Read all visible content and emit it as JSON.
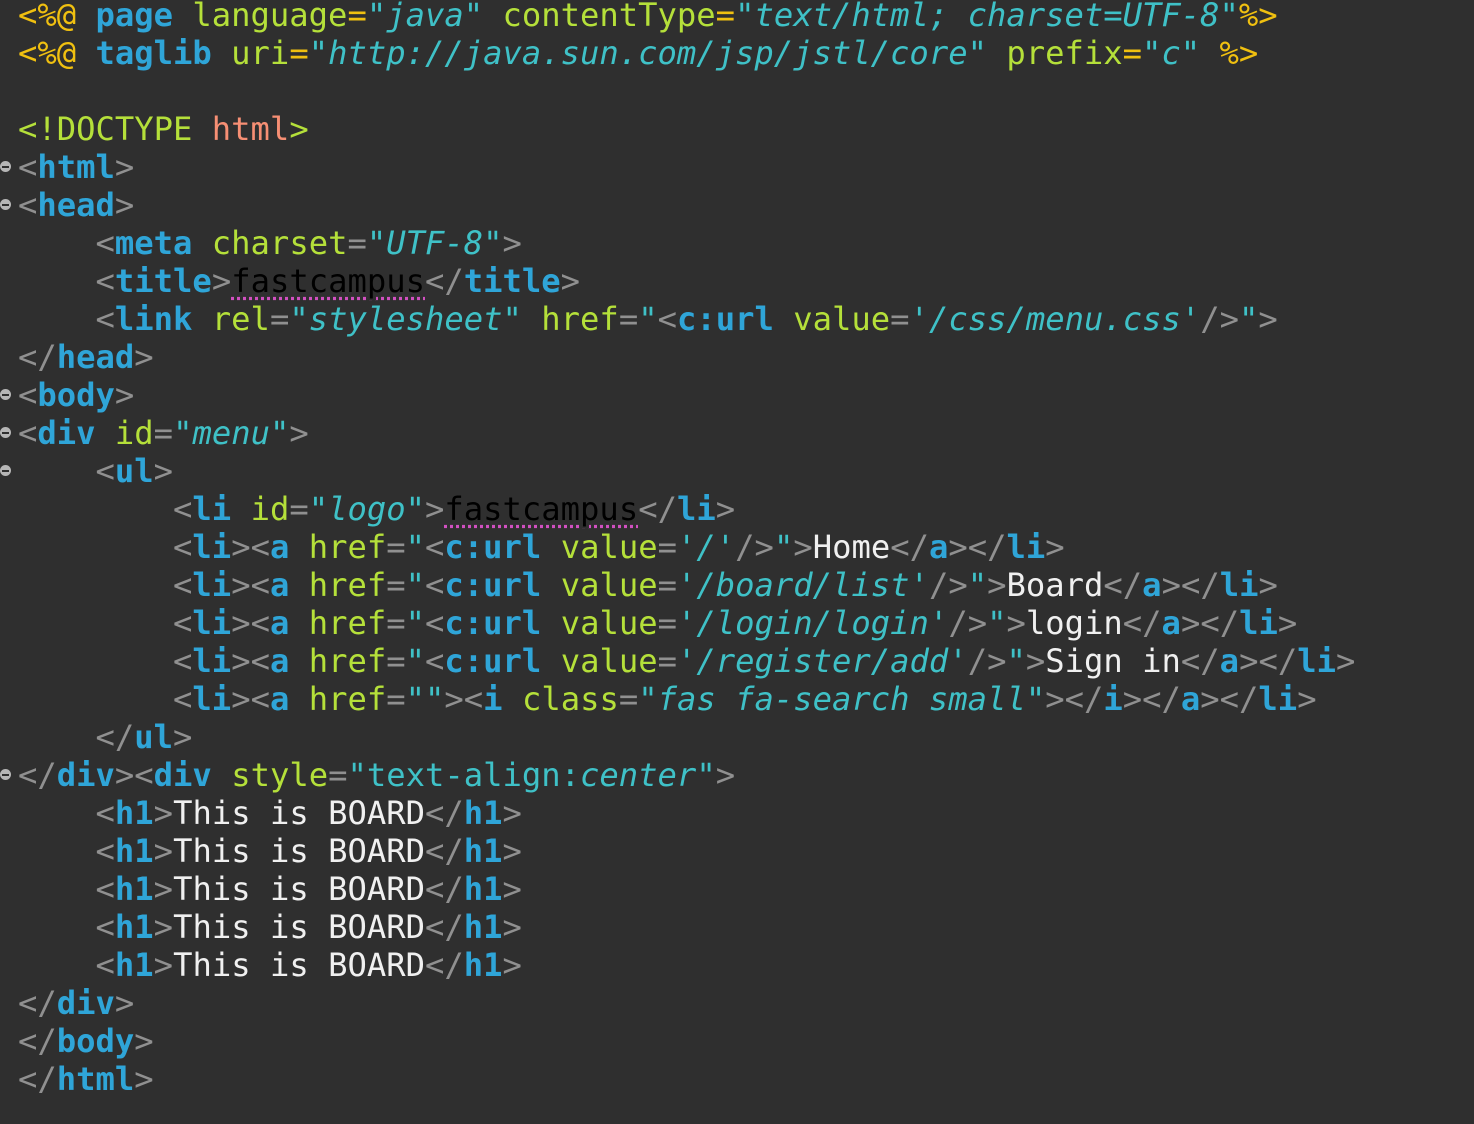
{
  "editor": {
    "lines": [
      [
        [
          "j",
          "<%@ "
        ],
        [
          "jk",
          "page"
        ],
        [
          "ja",
          " language"
        ],
        [
          "j",
          "="
        ],
        [
          "js",
          "\"java\""
        ],
        [
          "ja",
          " contentType"
        ],
        [
          "j",
          "="
        ],
        [
          "js",
          "\"text/html; charset=UTF-8\""
        ],
        [
          "j",
          "%>"
        ]
      ],
      [
        [
          "j",
          "<%@ "
        ],
        [
          "jk",
          "taglib"
        ],
        [
          "ja",
          " uri"
        ],
        [
          "j",
          "="
        ],
        [
          "js",
          "\"http://java.sun.com/jsp/jstl/core\""
        ],
        [
          "ja",
          " prefix"
        ],
        [
          "j",
          "="
        ],
        [
          "js",
          "\"c\""
        ],
        [
          "j",
          " %>"
        ]
      ],
      [],
      [
        [
          "dk",
          "<!DOCTYPE "
        ],
        [
          "dh",
          "html"
        ],
        [
          "dk",
          ">"
        ]
      ],
      [
        [
          "p",
          "<"
        ],
        [
          "t",
          "html"
        ],
        [
          "p",
          ">"
        ]
      ],
      [
        [
          "p",
          "<"
        ],
        [
          "t",
          "head"
        ],
        [
          "p",
          ">"
        ]
      ],
      [
        [
          "d",
          "    "
        ],
        [
          "p",
          "<"
        ],
        [
          "t",
          "meta"
        ],
        [
          "a",
          " charset"
        ],
        [
          "p",
          "="
        ],
        [
          "q",
          "\""
        ],
        [
          "s",
          "UTF-8"
        ],
        [
          "q",
          "\""
        ],
        [
          "p",
          ">"
        ]
      ],
      [
        [
          "d",
          "    "
        ],
        [
          "p",
          "<"
        ],
        [
          "t",
          "title"
        ],
        [
          "p",
          ">"
        ],
        [
          "sp",
          "fastcampus"
        ],
        [
          "p",
          "</"
        ],
        [
          "t",
          "title"
        ],
        [
          "p",
          ">"
        ]
      ],
      [
        [
          "d",
          "    "
        ],
        [
          "p",
          "<"
        ],
        [
          "t",
          "link"
        ],
        [
          "a",
          " rel"
        ],
        [
          "p",
          "="
        ],
        [
          "q",
          "\""
        ],
        [
          "s",
          "stylesheet"
        ],
        [
          "q",
          "\""
        ],
        [
          "a",
          " href"
        ],
        [
          "p",
          "="
        ],
        [
          "q",
          "\""
        ],
        [
          "p",
          "<"
        ],
        [
          "t",
          "c:url"
        ],
        [
          "a",
          " value"
        ],
        [
          "p",
          "="
        ],
        [
          "q",
          "'"
        ],
        [
          "s",
          "/css/menu.css"
        ],
        [
          "q",
          "'"
        ],
        [
          "p",
          "/>"
        ],
        [
          "q",
          "\""
        ],
        [
          "p",
          ">"
        ]
      ],
      [
        [
          "p",
          "</"
        ],
        [
          "t",
          "head"
        ],
        [
          "p",
          ">"
        ]
      ],
      [
        [
          "p",
          "<"
        ],
        [
          "t",
          "body"
        ],
        [
          "p",
          ">"
        ]
      ],
      [
        [
          "p",
          "<"
        ],
        [
          "t",
          "div"
        ],
        [
          "a",
          " id"
        ],
        [
          "p",
          "="
        ],
        [
          "q",
          "\""
        ],
        [
          "s",
          "menu"
        ],
        [
          "q",
          "\""
        ],
        [
          "p",
          ">"
        ]
      ],
      [
        [
          "d",
          "    "
        ],
        [
          "p",
          "<"
        ],
        [
          "t",
          "ul"
        ],
        [
          "p",
          ">"
        ]
      ],
      [
        [
          "d",
          "        "
        ],
        [
          "p",
          "<"
        ],
        [
          "t",
          "li"
        ],
        [
          "a",
          " id"
        ],
        [
          "p",
          "="
        ],
        [
          "q",
          "\""
        ],
        [
          "s",
          "logo"
        ],
        [
          "q",
          "\""
        ],
        [
          "p",
          ">"
        ],
        [
          "sp",
          "fastcampus"
        ],
        [
          "p",
          "</"
        ],
        [
          "t",
          "li"
        ],
        [
          "p",
          ">"
        ]
      ],
      [
        [
          "d",
          "        "
        ],
        [
          "p",
          "<"
        ],
        [
          "t",
          "li"
        ],
        [
          "p",
          "><"
        ],
        [
          "t",
          "a"
        ],
        [
          "a",
          " href"
        ],
        [
          "p",
          "="
        ],
        [
          "q",
          "\""
        ],
        [
          "p",
          "<"
        ],
        [
          "t",
          "c:url"
        ],
        [
          "a",
          " value"
        ],
        [
          "p",
          "="
        ],
        [
          "q",
          "'"
        ],
        [
          "s",
          "/"
        ],
        [
          "q",
          "'"
        ],
        [
          "p",
          "/>"
        ],
        [
          "q",
          "\""
        ],
        [
          "p",
          ">"
        ],
        [
          "d",
          "Home"
        ],
        [
          "p",
          "</"
        ],
        [
          "t",
          "a"
        ],
        [
          "p",
          "></"
        ],
        [
          "t",
          "li"
        ],
        [
          "p",
          ">"
        ]
      ],
      [
        [
          "d",
          "        "
        ],
        [
          "p",
          "<"
        ],
        [
          "t",
          "li"
        ],
        [
          "p",
          "><"
        ],
        [
          "t",
          "a"
        ],
        [
          "a",
          " href"
        ],
        [
          "p",
          "="
        ],
        [
          "q",
          "\""
        ],
        [
          "p",
          "<"
        ],
        [
          "t",
          "c:url"
        ],
        [
          "a",
          " value"
        ],
        [
          "p",
          "="
        ],
        [
          "q",
          "'"
        ],
        [
          "s",
          "/board/list"
        ],
        [
          "q",
          "'"
        ],
        [
          "p",
          "/>"
        ],
        [
          "q",
          "\""
        ],
        [
          "p",
          ">"
        ],
        [
          "d",
          "Board"
        ],
        [
          "p",
          "</"
        ],
        [
          "t",
          "a"
        ],
        [
          "p",
          "></"
        ],
        [
          "t",
          "li"
        ],
        [
          "p",
          ">"
        ]
      ],
      [
        [
          "d",
          "        "
        ],
        [
          "p",
          "<"
        ],
        [
          "t",
          "li"
        ],
        [
          "p",
          "><"
        ],
        [
          "t",
          "a"
        ],
        [
          "a",
          " href"
        ],
        [
          "p",
          "="
        ],
        [
          "q",
          "\""
        ],
        [
          "p",
          "<"
        ],
        [
          "t",
          "c:url"
        ],
        [
          "a",
          " value"
        ],
        [
          "p",
          "="
        ],
        [
          "q",
          "'"
        ],
        [
          "s",
          "/login/login"
        ],
        [
          "q",
          "'"
        ],
        [
          "p",
          "/>"
        ],
        [
          "q",
          "\""
        ],
        [
          "p",
          ">"
        ],
        [
          "d",
          "login"
        ],
        [
          "p",
          "</"
        ],
        [
          "t",
          "a"
        ],
        [
          "p",
          "></"
        ],
        [
          "t",
          "li"
        ],
        [
          "p",
          ">"
        ]
      ],
      [
        [
          "d",
          "        "
        ],
        [
          "p",
          "<"
        ],
        [
          "t",
          "li"
        ],
        [
          "p",
          "><"
        ],
        [
          "t",
          "a"
        ],
        [
          "a",
          " href"
        ],
        [
          "p",
          "="
        ],
        [
          "q",
          "\""
        ],
        [
          "p",
          "<"
        ],
        [
          "t",
          "c:url"
        ],
        [
          "a",
          " value"
        ],
        [
          "p",
          "="
        ],
        [
          "q",
          "'"
        ],
        [
          "s",
          "/register/add"
        ],
        [
          "q",
          "'"
        ],
        [
          "p",
          "/>"
        ],
        [
          "q",
          "\""
        ],
        [
          "p",
          ">"
        ],
        [
          "d",
          "Sign in"
        ],
        [
          "p",
          "</"
        ],
        [
          "t",
          "a"
        ],
        [
          "p",
          "></"
        ],
        [
          "t",
          "li"
        ],
        [
          "p",
          ">"
        ]
      ],
      [
        [
          "d",
          "        "
        ],
        [
          "p",
          "<"
        ],
        [
          "t",
          "li"
        ],
        [
          "p",
          "><"
        ],
        [
          "t",
          "a"
        ],
        [
          "a",
          " href"
        ],
        [
          "p",
          "="
        ],
        [
          "q",
          "\"\""
        ],
        [
          "p",
          "><"
        ],
        [
          "t",
          "i"
        ],
        [
          "a",
          " class"
        ],
        [
          "p",
          "="
        ],
        [
          "q",
          "\""
        ],
        [
          "s",
          "fas fa-search small"
        ],
        [
          "q",
          "\""
        ],
        [
          "p",
          "></"
        ],
        [
          "t",
          "i"
        ],
        [
          "p",
          "></"
        ],
        [
          "t",
          "a"
        ],
        [
          "p",
          "></"
        ],
        [
          "t",
          "li"
        ],
        [
          "p",
          ">"
        ]
      ],
      [
        [
          "d",
          "    "
        ],
        [
          "p",
          "</"
        ],
        [
          "t",
          "ul"
        ],
        [
          "p",
          ">"
        ]
      ],
      [
        [
          "p",
          "</"
        ],
        [
          "t",
          "div"
        ],
        [
          "p",
          "><"
        ],
        [
          "t",
          "div"
        ],
        [
          "a",
          " style"
        ],
        [
          "p",
          "="
        ],
        [
          "q",
          "\"text-align:"
        ],
        [
          "s",
          "center"
        ],
        [
          "q",
          "\""
        ],
        [
          "p",
          ">"
        ]
      ],
      [
        [
          "d",
          "    "
        ],
        [
          "p",
          "<"
        ],
        [
          "t",
          "h1"
        ],
        [
          "p",
          ">"
        ],
        [
          "d",
          "This is BOARD"
        ],
        [
          "p",
          "</"
        ],
        [
          "t",
          "h1"
        ],
        [
          "p",
          ">"
        ]
      ],
      [
        [
          "d",
          "    "
        ],
        [
          "p",
          "<"
        ],
        [
          "t",
          "h1"
        ],
        [
          "p",
          ">"
        ],
        [
          "d",
          "This is BOARD"
        ],
        [
          "p",
          "</"
        ],
        [
          "t",
          "h1"
        ],
        [
          "p",
          ">"
        ]
      ],
      [
        [
          "d",
          "    "
        ],
        [
          "p",
          "<"
        ],
        [
          "t",
          "h1"
        ],
        [
          "p",
          ">"
        ],
        [
          "d",
          "This is BOARD"
        ],
        [
          "p",
          "</"
        ],
        [
          "t",
          "h1"
        ],
        [
          "p",
          ">"
        ]
      ],
      [
        [
          "d",
          "    "
        ],
        [
          "p",
          "<"
        ],
        [
          "t",
          "h1"
        ],
        [
          "p",
          ">"
        ],
        [
          "d",
          "This is BOARD"
        ],
        [
          "p",
          "</"
        ],
        [
          "t",
          "h1"
        ],
        [
          "p",
          ">"
        ]
      ],
      [
        [
          "d",
          "    "
        ],
        [
          "p",
          "<"
        ],
        [
          "t",
          "h1"
        ],
        [
          "p",
          ">"
        ],
        [
          "d",
          "This is BOARD"
        ],
        [
          "p",
          "</"
        ],
        [
          "t",
          "h1"
        ],
        [
          "p",
          ">"
        ]
      ],
      [
        [
          "p",
          "</"
        ],
        [
          "t",
          "div"
        ],
        [
          "p",
          ">"
        ]
      ],
      [
        [
          "p",
          "</"
        ],
        [
          "t",
          "body"
        ],
        [
          "p",
          ">"
        ]
      ],
      [
        [
          "p",
          "</"
        ],
        [
          "t",
          "html"
        ],
        [
          "p",
          ">"
        ]
      ]
    ],
    "fold_markers": [
      4,
      5,
      10,
      11,
      12,
      20
    ],
    "current_line": 28
  }
}
